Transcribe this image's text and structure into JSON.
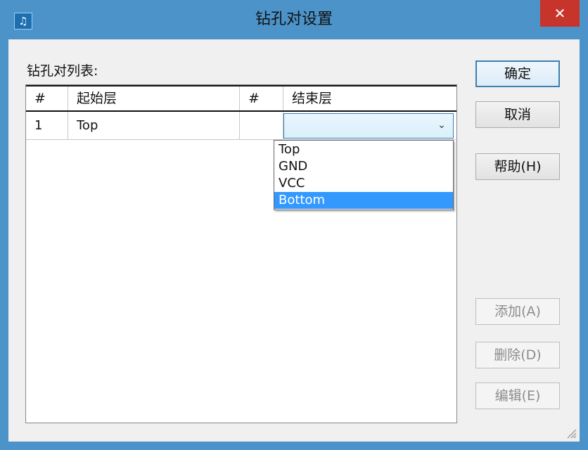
{
  "window": {
    "title": "钻孔对设置",
    "icon": "app-music-icon",
    "icon_glyph": "♫",
    "close_glyph": "✕"
  },
  "list": {
    "label": "钻孔对列表:",
    "columns": [
      "#",
      "起始层",
      "#",
      "结束层"
    ],
    "rows": [
      {
        "num1": "1",
        "start": "Top",
        "num2": "",
        "end": ""
      }
    ],
    "dropdown": {
      "arrow_glyph": "⌄",
      "options": [
        "Top",
        "GND",
        "VCC",
        "Bottom"
      ],
      "highlighted": "Bottom"
    }
  },
  "buttons": {
    "ok": "确定",
    "cancel": "取消",
    "help": "帮助(H)",
    "add": "添加(A)",
    "delete": "删除(D)",
    "edit": "编辑(E)"
  },
  "colors": {
    "titlebar": "#4b93c8",
    "close": "#c7342b",
    "highlight": "#3399ff"
  }
}
